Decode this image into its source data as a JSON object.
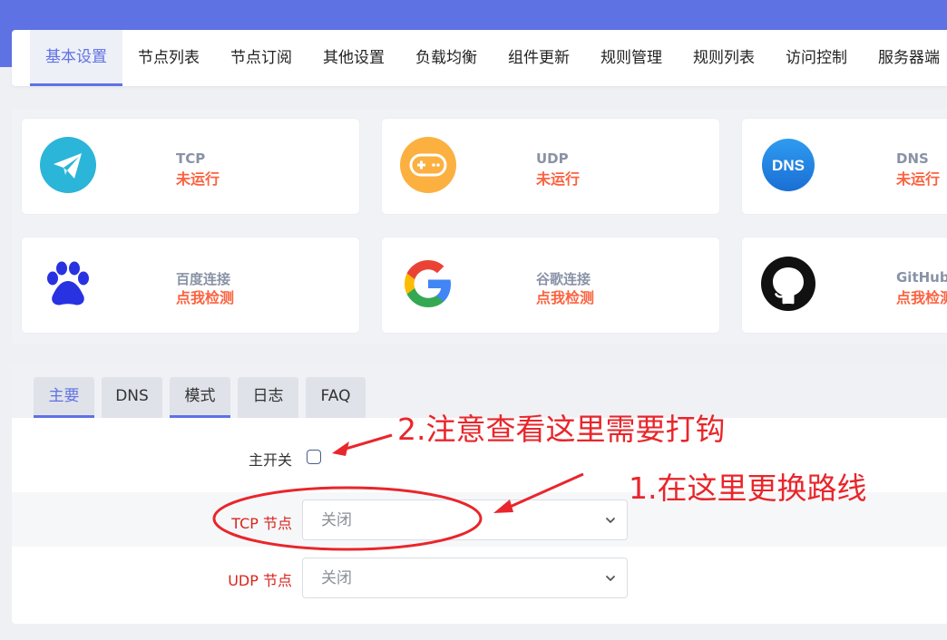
{
  "nav": {
    "tabs": [
      "基本设置",
      "节点列表",
      "节点订阅",
      "其他设置",
      "负载均衡",
      "组件更新",
      "规则管理",
      "规则列表",
      "访问控制",
      "服务器端"
    ],
    "active_index": 0
  },
  "status_cards": [
    {
      "title": "TCP",
      "status": "未运行",
      "icon": "paper-plane-icon"
    },
    {
      "title": "UDP",
      "status": "未运行",
      "icon": "gamepad-icon"
    },
    {
      "title": "DNS",
      "status": "未运行",
      "icon": "dns-icon",
      "icon_text": "DNS"
    },
    {
      "title": "百度连接",
      "status": "点我检测",
      "icon": "baidu-paw-icon"
    },
    {
      "title": "谷歌连接",
      "status": "点我检测",
      "icon": "google-icon"
    },
    {
      "title": "GitHub",
      "status": "点我检测",
      "icon": "github-icon"
    }
  ],
  "settings": {
    "tabs": [
      "主要",
      "DNS",
      "模式",
      "日志",
      "FAQ"
    ],
    "active_tab": "主要",
    "main_switch_label": "主开关",
    "main_switch_checked": false,
    "tcp_node_label": "TCP 节点",
    "tcp_node_value": "关闭",
    "udp_node_label": "UDP 节点",
    "udp_node_value": "关闭"
  },
  "annotations": {
    "note_2": "2.注意查看这里需要打钩",
    "note_1": "1.在这里更换路线"
  },
  "colors": {
    "brand": "#5e72e4",
    "status_warning": "#fb6340",
    "annotation_red": "#e8262b",
    "label_red": "#d9251d"
  }
}
